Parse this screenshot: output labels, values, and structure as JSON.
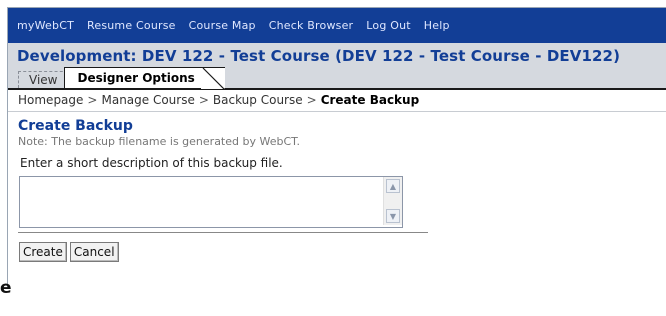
{
  "topnav": {
    "items": [
      "myWebCT",
      "Resume Course",
      "Course Map",
      "Check Browser",
      "Log Out",
      "Help"
    ]
  },
  "header": {
    "course_title": "Development: DEV 122 - Test Course  (DEV 122 - Test Course - DEV122)",
    "tabs": {
      "view": "View",
      "designer": "Designer Options"
    }
  },
  "breadcrumb": {
    "items": [
      "Homepage",
      "Manage Course",
      "Backup Course"
    ],
    "separator": ">",
    "current": "Create Backup"
  },
  "main": {
    "heading": "Create Backup",
    "note": "Note: The backup filename is generated by WebCT.",
    "field_label": "Enter a short description of this backup file.",
    "description_value": ""
  },
  "actions": {
    "create_label": "Create",
    "cancel_label": "Cancel"
  },
  "stray_text": "e",
  "colors": {
    "nav_bg": "#123e96",
    "header_bg": "#d5d9df",
    "title": "#123e96"
  }
}
